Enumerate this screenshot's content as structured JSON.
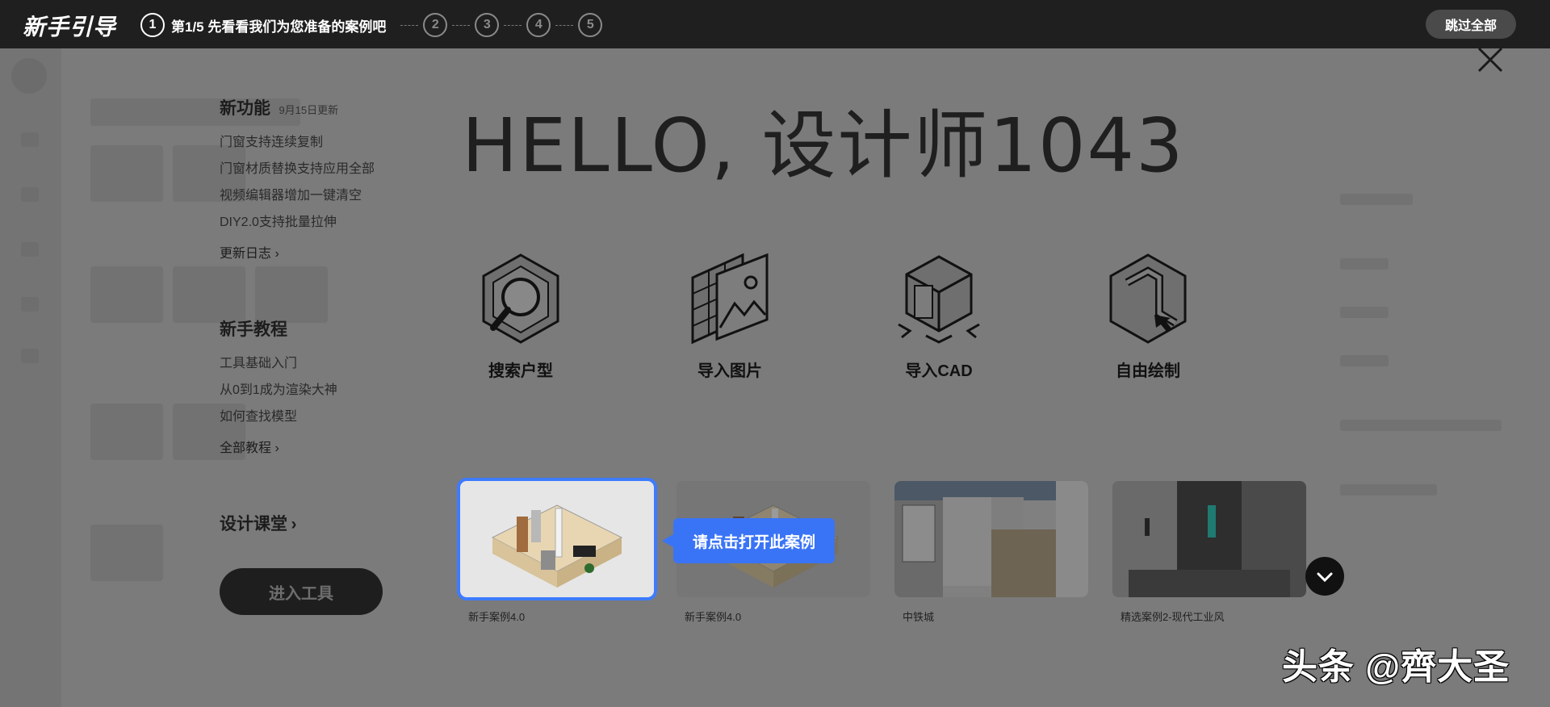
{
  "guide": {
    "title": "新手引导",
    "steps": [
      {
        "num": "1",
        "text": "第1/5 先看看我们为您准备的案例吧",
        "active": true
      },
      {
        "num": "2",
        "active": false
      },
      {
        "num": "3",
        "active": false
      },
      {
        "num": "4",
        "active": false
      },
      {
        "num": "5",
        "active": false
      }
    ],
    "skip_label": "跳过全部"
  },
  "left": {
    "new_features": {
      "title": "新功能",
      "date": "9月15日更新",
      "items": [
        "门窗支持连续复制",
        "门窗材质替换支持应用全部",
        "视频编辑器增加一键清空",
        "DIY2.0支持批量拉伸"
      ],
      "more": "更新日志"
    },
    "tutorials": {
      "title": "新手教程",
      "items": [
        "工具基础入门",
        "从0到1成为渲染大神",
        "如何查找模型"
      ],
      "more": "全部教程"
    },
    "classroom": "设计课堂",
    "enter_tool": "进入工具"
  },
  "hello": "HELLO, 设计师1043",
  "actions": [
    {
      "label": "搜索户型",
      "icon": "search-floorplan-icon"
    },
    {
      "label": "导入图片",
      "icon": "import-image-icon"
    },
    {
      "label": "导入CAD",
      "icon": "import-cad-icon"
    },
    {
      "label": "自由绘制",
      "icon": "free-draw-icon"
    }
  ],
  "cases": [
    {
      "name": "新手案例4.0",
      "active": true
    },
    {
      "name": "新手案例4.0",
      "active": false
    },
    {
      "name": "中铁城",
      "active": false
    },
    {
      "name": "精选案例2-现代工业风",
      "active": false
    }
  ],
  "tip": "请点击打开此案例",
  "watermark": "头条 @齊大圣",
  "colors": {
    "accent": "#3a74f6",
    "topbar": "#1f1f1f",
    "overlay": "#7a7a7a"
  }
}
